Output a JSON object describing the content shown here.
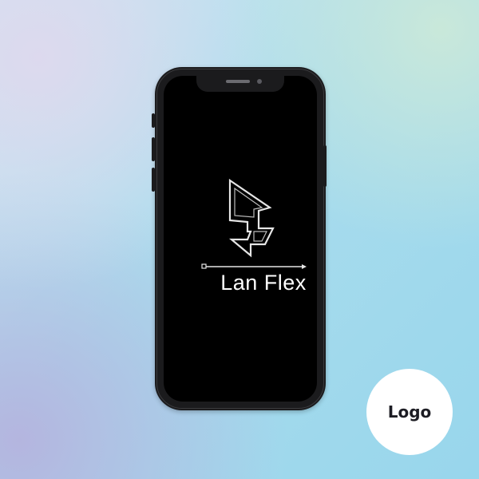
{
  "brand": {
    "name": "Lan Flex",
    "mark_icon": "lightning-f-outline-icon",
    "mark_color": "#e6e6e6",
    "text_color": "#ffffff"
  },
  "badge": {
    "label": "Logo",
    "background": "#ffffff",
    "text_color": "#1d1d24"
  },
  "device": {
    "type": "smartphone",
    "frame_color": "#1b1b1d",
    "screen_color": "#000000"
  }
}
